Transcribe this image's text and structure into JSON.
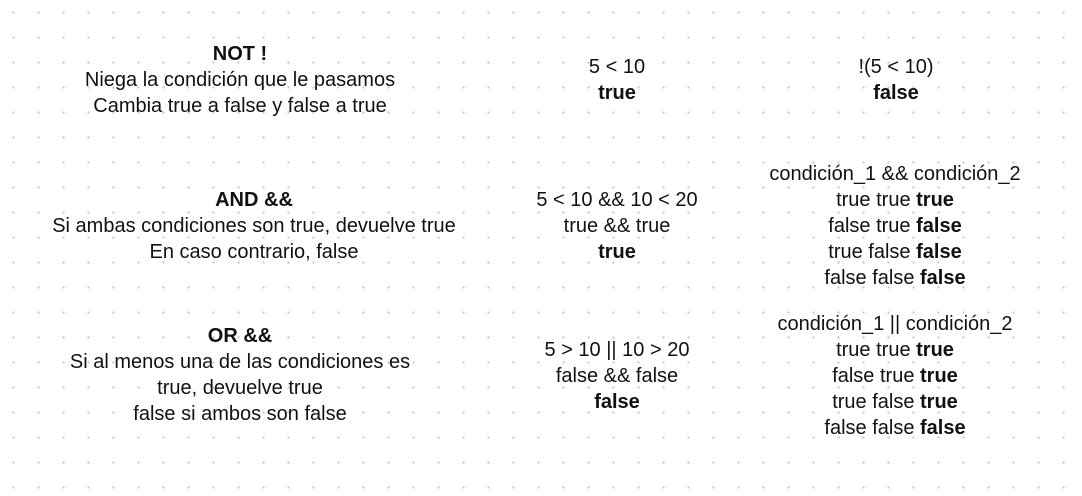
{
  "not": {
    "title": "NOT !",
    "desc": [
      "Niega la condición que le pasamos",
      "Cambia true a false y false a true"
    ],
    "example": "5 < 10",
    "example_result": "true",
    "negated": "!(5 < 10)",
    "negated_result": "false"
  },
  "and": {
    "title": "AND &&",
    "desc": [
      "Si ambas condiciones son true, devuelve true",
      "En caso contrario, false"
    ],
    "example": "5 < 10 && 10 < 20",
    "example_eval": "true && true",
    "example_result": "true",
    "table_header": "condición_1 && condición_2",
    "table_rows": [
      {
        "inputs": "true true ",
        "result": "true"
      },
      {
        "inputs": "false true ",
        "result": "false"
      },
      {
        "inputs": "true false ",
        "result": "false"
      },
      {
        "inputs": "false false ",
        "result": "false"
      }
    ]
  },
  "or": {
    "title": "OR &&",
    "desc": [
      "Si al menos una de las condiciones es",
      "true, devuelve true",
      "false si ambos son false"
    ],
    "example": "5 > 10 || 10 > 20",
    "example_eval": "false && false",
    "example_result": "false",
    "table_header": "condición_1 || condición_2",
    "table_rows": [
      {
        "inputs": "true true ",
        "result": "true"
      },
      {
        "inputs": "false true ",
        "result": "true"
      },
      {
        "inputs": "true false ",
        "result": "true"
      },
      {
        "inputs": "false false ",
        "result": "false"
      }
    ]
  }
}
